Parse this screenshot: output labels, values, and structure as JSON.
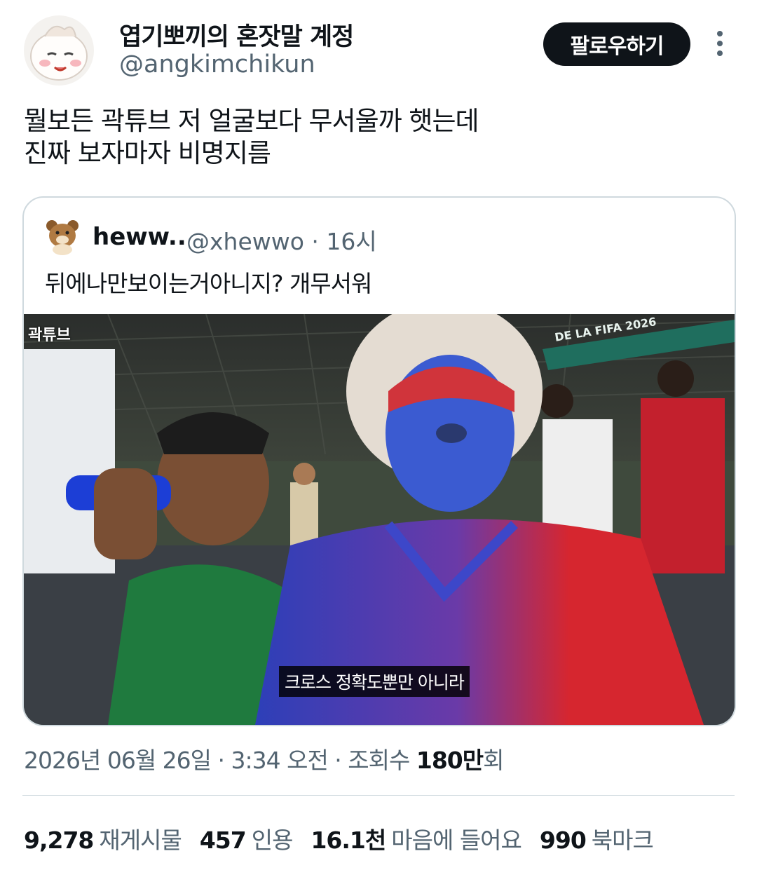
{
  "author": {
    "display_name": "엽기뽀끼의 혼잣말 계정",
    "handle": "@angkimchikun"
  },
  "follow_label": "팔로우하기",
  "tweet": {
    "lines": [
      "뭘보든 곽튜브 저 얼굴보다 무서울까 햇는데",
      "진짜 보자마자 비명지름"
    ]
  },
  "quote": {
    "name": "heww..",
    "handle": "@xhewwo · 16시",
    "text": "뒤에나만보이는거아니지?  개무서워",
    "media": {
      "watermark": "곽튜브",
      "banner": "DE LA FIFA 2026",
      "subtitle": "크로스 정확도뿐만 아니라"
    }
  },
  "meta": {
    "timestamp": "2026년 06월 26일 · 3:34 오전 · 조회수 ",
    "views": "180만",
    "views_suffix": "회"
  },
  "stats": [
    {
      "value": "9,278",
      "label": "재게시물"
    },
    {
      "value": "457",
      "label": "인용"
    },
    {
      "value": "16.1천",
      "label": "마음에 들어요"
    },
    {
      "value": "990",
      "label": "북마크"
    }
  ],
  "colors": {
    "text": "#0f1419",
    "secondary": "#536471",
    "border": "#cfd9de",
    "button": "#0f1419"
  }
}
